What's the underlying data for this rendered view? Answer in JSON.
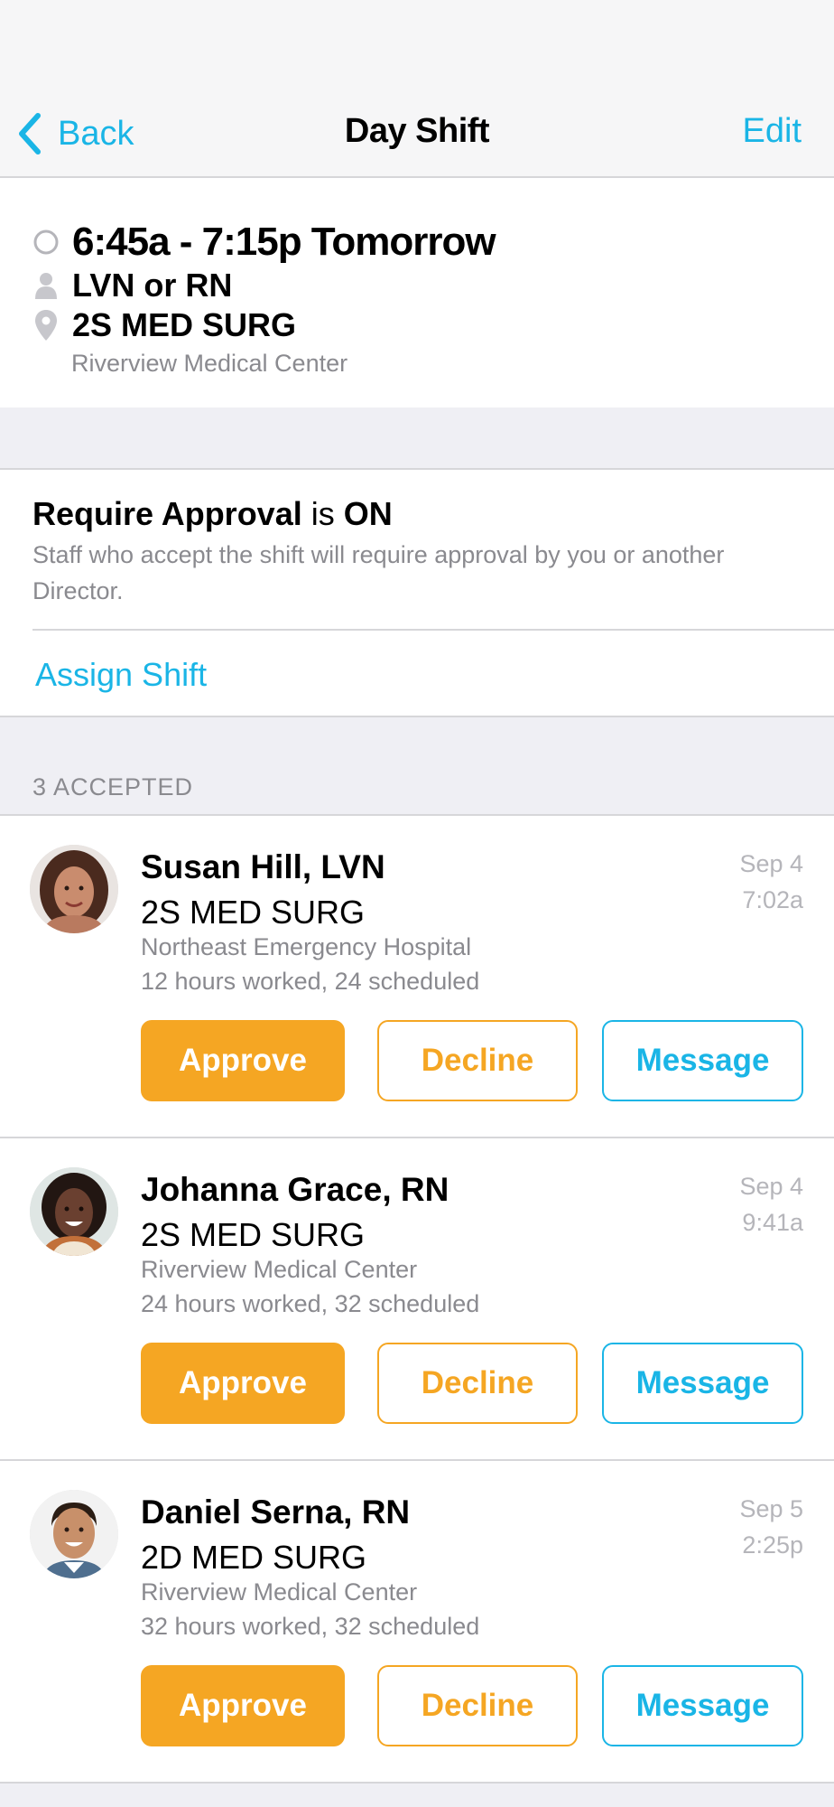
{
  "nav": {
    "back_label": "Back",
    "title": "Day Shift",
    "edit_label": "Edit"
  },
  "shift": {
    "time": "6:45a - 7:15p Tomorrow",
    "role": "LVN or RN",
    "unit": "2S MED SURG",
    "facility": "Riverview Medical Center"
  },
  "approval": {
    "title_part1": "Require Approval",
    "title_part2": "is",
    "title_part3": "ON",
    "description": "Staff who accept the shift will require approval by you or another Director.",
    "assign_label": "Assign Shift"
  },
  "accepted": {
    "header": "3 ACCEPTED",
    "staff": [
      {
        "name": "Susan Hill, LVN",
        "unit": "2S MED SURG",
        "facility": "Northeast Emergency Hospital",
        "hours": "12 hours worked, 24 scheduled",
        "date": "Sep 4",
        "time": "7:02a",
        "approve_label": "Approve",
        "decline_label": "Decline",
        "message_label": "Message"
      },
      {
        "name": "Johanna Grace, RN",
        "unit": "2S MED SURG",
        "facility": "Riverview Medical Center",
        "hours": "24 hours worked, 32 scheduled",
        "date": "Sep 4",
        "time": "9:41a",
        "approve_label": "Approve",
        "decline_label": "Decline",
        "message_label": "Message"
      },
      {
        "name": "Daniel Serna, RN",
        "unit": "2D MED SURG",
        "facility": "Riverview Medical Center",
        "hours": "32 hours worked, 32 scheduled",
        "date": "Sep 5",
        "time": "2:25p",
        "approve_label": "Approve",
        "decline_label": "Decline",
        "message_label": "Message"
      }
    ]
  },
  "colors": {
    "accent_blue": "#1ab5e6",
    "accent_orange": "#f5a623",
    "secondary_text": "#8a8a8f"
  },
  "icons": [
    "chevron-left-icon",
    "clock-icon",
    "person-icon",
    "location-pin-icon"
  ]
}
